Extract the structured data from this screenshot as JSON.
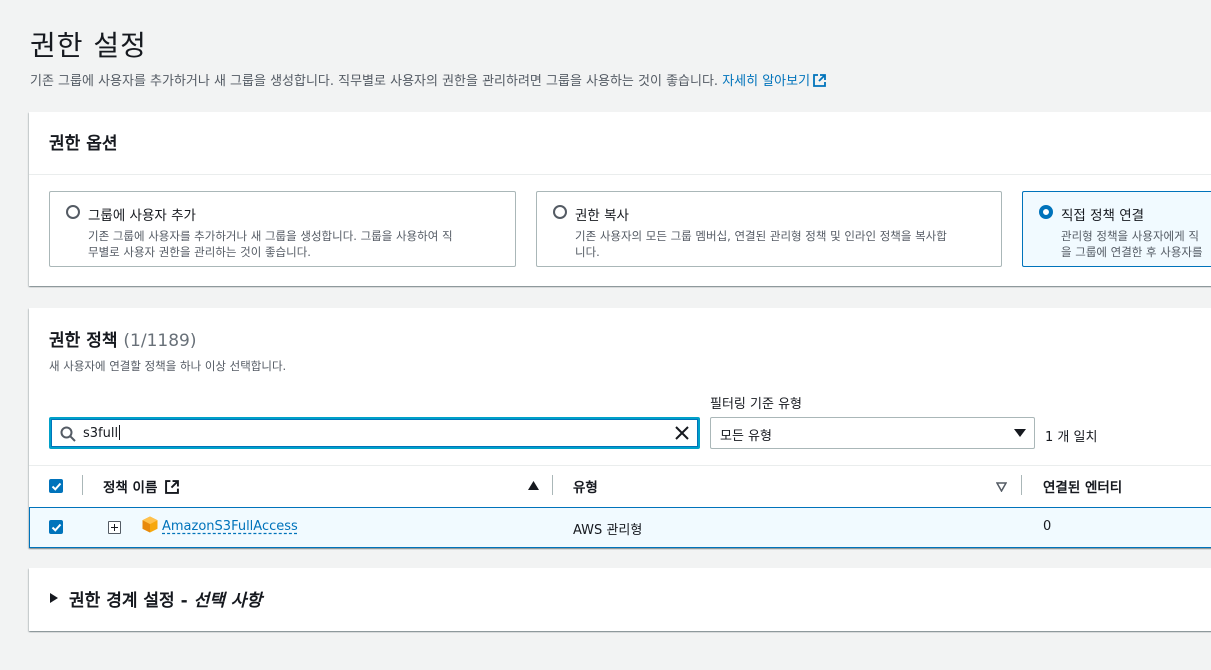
{
  "header": {
    "title": "권한 설정",
    "description": "기존 그룹에 사용자를 추가하거나 새 그룹을 생성합니다. 직무별로 사용자의 권한을 관리하려면 그룹을 사용하는 것이 좋습니다.",
    "learn_more": "자세히 알아보기"
  },
  "options": {
    "title": "권한 옵션",
    "tiles": [
      {
        "label": "그룹에 사용자 추가",
        "description": "기존 그룹에 사용자를 추가하거나 새 그룹을 생성합니다. 그룹을 사용하여 직\n무별로 사용자 권한을 관리하는 것이 좋습니다.",
        "selected": false
      },
      {
        "label": "권한 복사",
        "description": "기존 사용자의 모든 그룹 멤버십, 연결된 관리형 정책 및 인라인 정책을 복사합\n니다.",
        "selected": false
      },
      {
        "label": "직접 정책 연결",
        "description": "관리형 정책을 사용자에게 직\n을 그룹에 연결한 후 사용자를",
        "selected": true
      }
    ]
  },
  "policies": {
    "title": "권한 정책",
    "count": "(1/1189)",
    "description": "새 사용자에 연결할 정책을 하나 이상 선택합니다.",
    "search_value": "s3full",
    "filter_label": "필터링 기준 유형",
    "filter_value": "모든 유형",
    "match_count": "1 개 일치",
    "columns": {
      "name": "정책 이름",
      "type": "유형",
      "entities": "연결된 엔터티"
    },
    "rows": [
      {
        "name": "AmazonS3FullAccess",
        "type": "AWS 관리형",
        "entities": "0",
        "selected": true
      }
    ]
  },
  "boundary": {
    "title": "권한 경계 설정 -",
    "optional": "선택 사항"
  },
  "colors": {
    "link": "#0073bb",
    "selected_bg": "#f1faff",
    "policy_icon": "#f7a80d"
  }
}
